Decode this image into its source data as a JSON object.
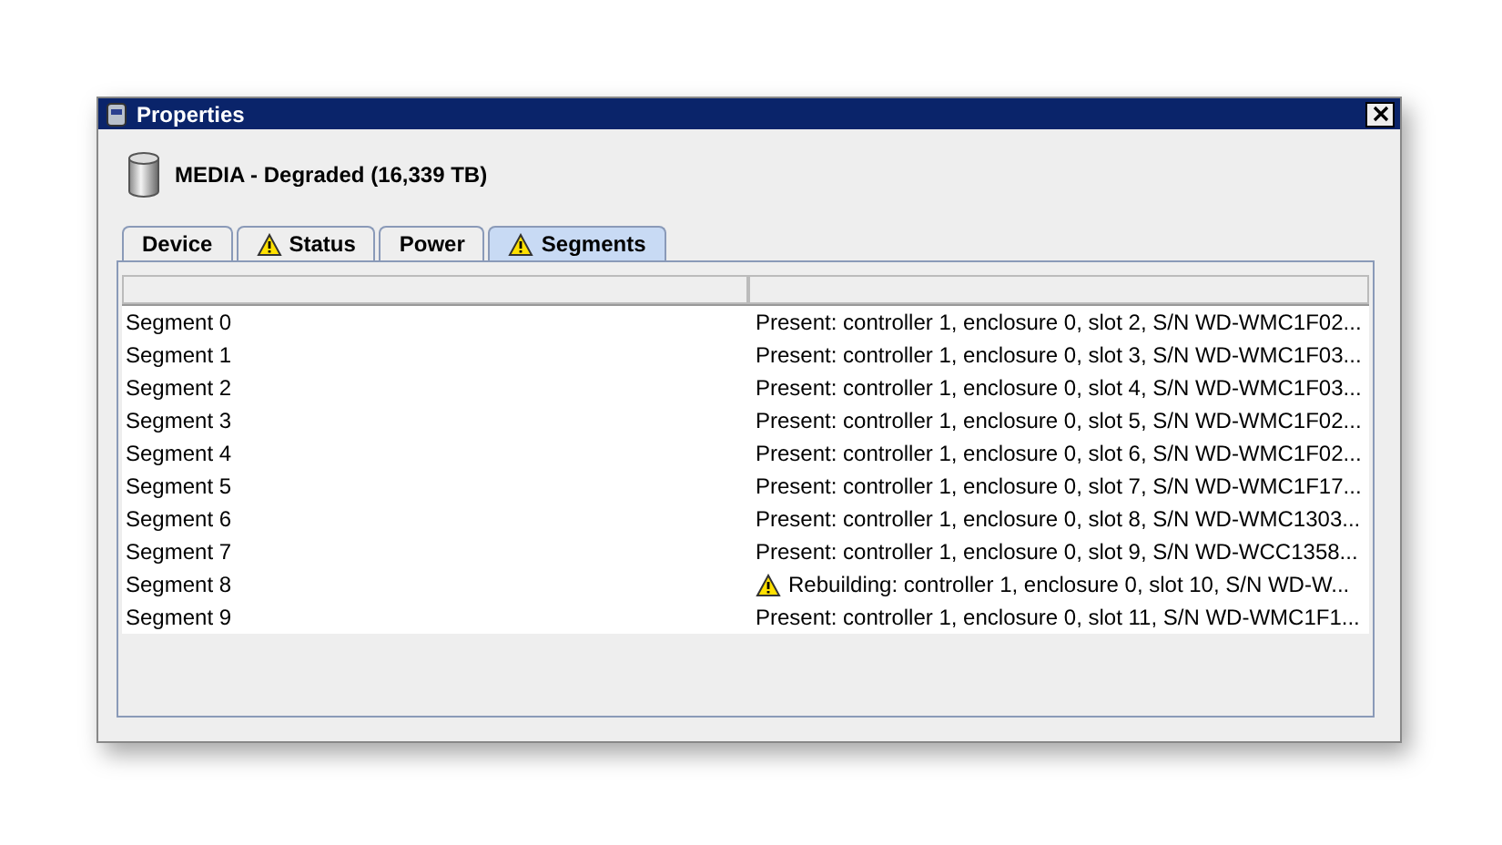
{
  "window": {
    "title": "Properties"
  },
  "header": {
    "title": "MEDIA - Degraded (16,339 TB)"
  },
  "tabs": [
    {
      "label": "Device",
      "selected": false,
      "warning": false
    },
    {
      "label": "Status",
      "selected": false,
      "warning": true
    },
    {
      "label": "Power",
      "selected": false,
      "warning": false
    },
    {
      "label": "Segments",
      "selected": true,
      "warning": true
    }
  ],
  "table": {
    "rows": [
      {
        "name": "Segment 0",
        "status": "Present: controller 1, enclosure 0, slot 2, S/N WD-WMC1F02...",
        "warning": false
      },
      {
        "name": "Segment 1",
        "status": "Present: controller 1, enclosure 0, slot 3, S/N WD-WMC1F03...",
        "warning": false
      },
      {
        "name": "Segment 2",
        "status": "Present: controller 1, enclosure 0, slot 4, S/N WD-WMC1F03...",
        "warning": false
      },
      {
        "name": "Segment 3",
        "status": "Present: controller 1, enclosure 0, slot 5, S/N WD-WMC1F02...",
        "warning": false
      },
      {
        "name": "Segment 4",
        "status": "Present: controller 1, enclosure 0, slot 6, S/N WD-WMC1F02...",
        "warning": false
      },
      {
        "name": "Segment 5",
        "status": "Present: controller 1, enclosure 0, slot 7, S/N WD-WMC1F17...",
        "warning": false
      },
      {
        "name": "Segment 6",
        "status": "Present: controller 1, enclosure 0, slot 8, S/N WD-WMC1303...",
        "warning": false
      },
      {
        "name": "Segment 7",
        "status": "Present: controller 1, enclosure 0, slot 9, S/N WD-WCC1358...",
        "warning": false
      },
      {
        "name": "Segment 8",
        "status": "Rebuilding: controller 1, enclosure 0, slot 10, S/N WD-W...",
        "warning": true
      },
      {
        "name": "Segment 9",
        "status": "Present: controller 1, enclosure 0, slot 11, S/N WD-WMC1F1...",
        "warning": false
      }
    ]
  }
}
